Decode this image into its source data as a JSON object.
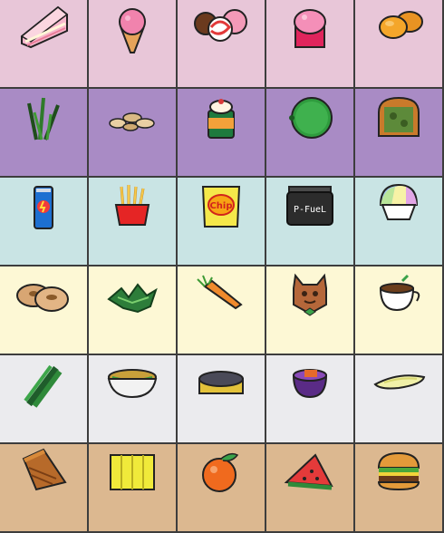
{
  "inventory": {
    "rows": [
      {
        "tone": "pink",
        "items": [
          "cake-slice-icon",
          "ice-cream-cone-icon",
          "candy-icon",
          "cupcake-icon",
          "bread-rolls-icon"
        ]
      },
      {
        "tone": "purple",
        "items": [
          "grass-icon",
          "peanuts-icon",
          "pudding-cup-icon",
          "melon-icon",
          "toast-icon"
        ]
      },
      {
        "tone": "teal",
        "items": [
          "energy-drink-icon",
          "fries-icon",
          "chips-bag-icon",
          "protein-tub-icon",
          "shaved-ice-icon"
        ]
      },
      {
        "tone": "cream",
        "items": [
          "bagels-icon",
          "leafy-greens-icon",
          "carrot-icon",
          "cookie-cat-icon",
          "coffee-cup-icon"
        ]
      },
      {
        "tone": "grey",
        "items": [
          "celery-icon",
          "noodle-bowl-icon",
          "tart-icon",
          "berry-bowl-icon",
          "cucumber-icon"
        ]
      },
      {
        "tone": "tan",
        "items": [
          "pie-slice-icon",
          "cheese-icon",
          "peach-icon",
          "watermelon-icon",
          "burger-icon"
        ]
      }
    ],
    "labels": {
      "protein_tub": "P-FueL",
      "chips_bag": "Chip"
    },
    "colors": {
      "pink": "#e8c6d8",
      "purple": "#a98bc5",
      "teal": "#c9e4e4",
      "cream": "#fdf8d5",
      "grey": "#ebebee",
      "tan": "#dcb890",
      "border": "#3d3d3d"
    }
  }
}
